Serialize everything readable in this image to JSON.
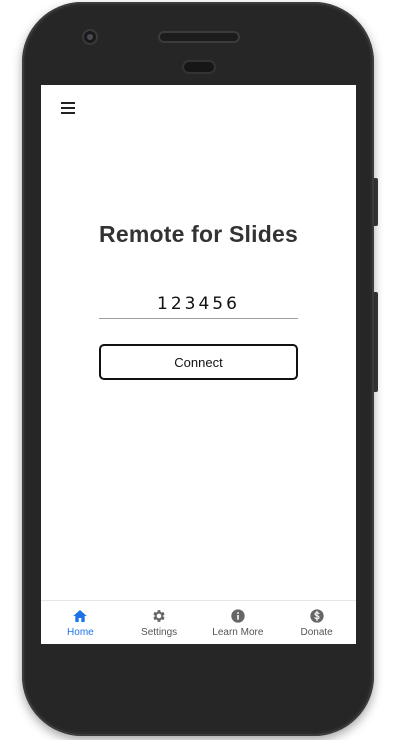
{
  "app": {
    "title": "Remote for Slides"
  },
  "header": {
    "menu_icon": "hamburger-menu-icon"
  },
  "code_field": {
    "value": "123456"
  },
  "connect_button": {
    "label": "Connect"
  },
  "bottom_nav": {
    "active_color": "#1a73e8",
    "inactive_color": "#666666",
    "items": [
      {
        "label": "Home",
        "icon": "home-icon",
        "active": true
      },
      {
        "label": "Settings",
        "icon": "gear-icon",
        "active": false
      },
      {
        "label": "Learn More",
        "icon": "info-icon",
        "active": false
      },
      {
        "label": "Donate",
        "icon": "dollar-icon",
        "active": false
      }
    ]
  }
}
